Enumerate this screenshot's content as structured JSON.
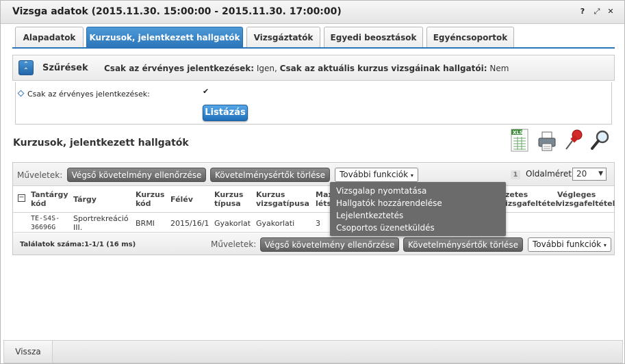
{
  "dialog": {
    "title": "Vizsga adatok (2015.11.30. 15:00:00 - 2015.11.30. 17:00:00)",
    "help_label": "?",
    "popout_label": "⤢",
    "close_label": "✕"
  },
  "tabs": [
    {
      "label": "Alapadatok"
    },
    {
      "label": "Kurzusok, jelentkezett hallgatók"
    },
    {
      "label": "Vizsgáztatók"
    },
    {
      "label": "Egyedi beosztások"
    },
    {
      "label": "Egyéncsoportok"
    }
  ],
  "filter": {
    "title": "Szűrések",
    "summary_label1": "Csak az érvényes jelentkezések:",
    "summary_value1": " Igen, ",
    "summary_label2": "Csak az aktuális kurzus vizsgáinak hallgatói:",
    "summary_value2": " Nem",
    "field_label": "Csak az érvényes jelentkezések:",
    "checked": true,
    "list_button": "Listázás"
  },
  "section_title": "Kurzusok, jelentkezett hallgatók",
  "toolbar_icons": [
    "excel-export-icon",
    "print-icon",
    "pin-icon",
    "search-icon"
  ],
  "grid": {
    "ops_label": "Műveletek:",
    "btn_final_check": "Végső követelmény ellenőrzése",
    "btn_delete_evaluators": "Követelménysértők törlése",
    "btn_more": "További funkciók",
    "page_number": "1",
    "pagesize_label": "Oldalméret",
    "pagesize_value": "20",
    "columns": [
      {
        "line1": "Tantárgy",
        "line2": "kód"
      },
      {
        "line1": "Tárgy",
        "line2": ""
      },
      {
        "line1": "Kurzus",
        "line2": "kód"
      },
      {
        "line1": "Félév",
        "line2": ""
      },
      {
        "line1": "Kurzus",
        "line2": "típusa"
      },
      {
        "line1": "Kurzus",
        "line2": "vizsgatípusa"
      },
      {
        "line1": "Max",
        "line2": "léts"
      },
      {
        "line1": "zetes",
        "line2": "izsgafeltétel"
      },
      {
        "line1": "Végleges",
        "line2": "vizsgafeltétel"
      }
    ],
    "rows": [
      {
        "code_line1": "TE-S4S-",
        "code_line2": "36696G",
        "subject_line1": "Sportrekreáció",
        "subject_line2": "III.",
        "course_code": "BRMI",
        "semester": "2015/16/1",
        "course_type": "Gyakorlat",
        "exam_type": "Gyakorlati",
        "max": "3"
      }
    ],
    "result_text": "Találatok száma:1-1/1 (16 ms)"
  },
  "dropdown_menu": [
    {
      "label": "Vizsgalap nyomtatása"
    },
    {
      "label": "Hallgatók hozzárendelése"
    },
    {
      "label": "Lejelentkeztetés"
    },
    {
      "label": "Csoportos üzenetküldés"
    }
  ],
  "footer": {
    "back_label": "Vissza"
  }
}
